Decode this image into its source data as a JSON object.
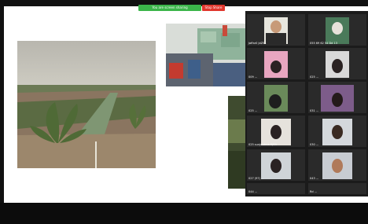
{
  "share_bar": {
    "status_text": "You are screen sharing",
    "stop_label": "Stop Share"
  },
  "gallery": {
    "tiles": [
      {
        "name": "Jaffar0 JdZ51"
      },
      {
        "name": "055 69 62 54 Dd 13"
      },
      {
        "name": "009 ..."
      },
      {
        "name": "025 ..."
      },
      {
        "name": "025 ..."
      },
      {
        "name": "031 ..."
      },
      {
        "name": "025 sunjuishna S/G1"
      },
      {
        "name": "030 ..."
      },
      {
        "name": "027 (97) ..."
      },
      {
        "name": "043 ..."
      },
      {
        "name": "044 ..."
      },
      {
        "name": "Rd ..."
      }
    ]
  }
}
